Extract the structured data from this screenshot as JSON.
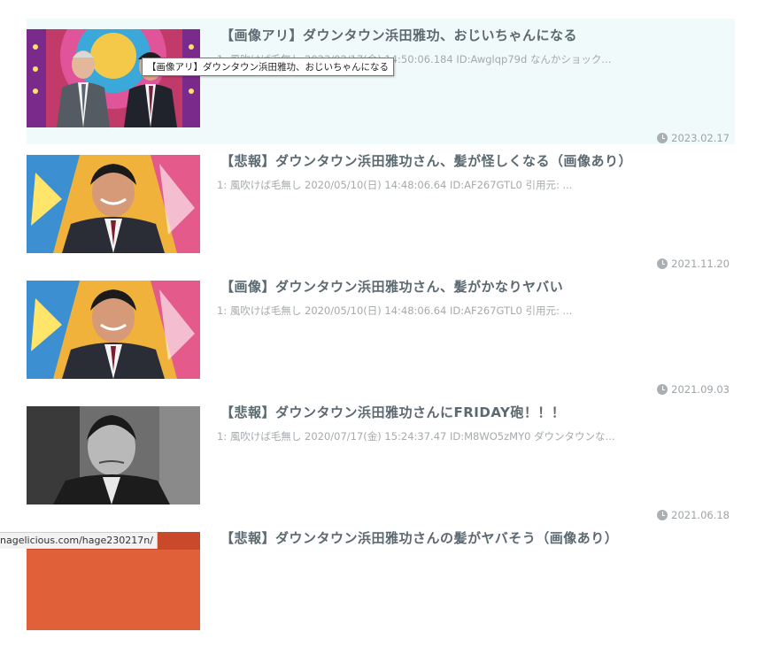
{
  "posts": [
    {
      "title": "【画像アリ】ダウンタウン浜田雅功、おじいちゃんになる",
      "excerpt": "1: 風吹けば毛無し 2023/02/17(金) 14:50:06.184 ID:Awglqp79d なんかショック...",
      "date": "2023.02.17"
    },
    {
      "title": "【悲報】ダウンタウン浜田雅功さん、髪が怪しくなる（画像あり）",
      "excerpt": "1: 風吹けば毛無し 2020/05/10(日) 14:48:06.64 ID:AF267GTL0 引用元: ...",
      "date": "2021.11.20"
    },
    {
      "title": "【画像】ダウンタウン浜田雅功さん、髪がかなりヤバい",
      "excerpt": "1: 風吹けば毛無し 2020/05/10(日) 14:48:06.64 ID:AF267GTL0 引用元: ...",
      "date": "2021.09.03"
    },
    {
      "title": "【悲報】ダウンタウン浜田雅功さんにFRIDAY砲！！！",
      "excerpt": "1: 風吹けば毛無し 2020/07/17(金) 15:24:37.47 ID:M8WO5zMY0 ダウンタウンな...",
      "date": "2021.06.18"
    },
    {
      "title": "【悲報】ダウンタウン浜田雅功さんの髪がヤバそう（画像あり）",
      "excerpt": "",
      "date": ""
    }
  ],
  "tooltip": "【画像アリ】ダウンタウン浜田雅功、おじいちゃんになる",
  "status_url": "nagelicious.com/hage230217n/",
  "icons": {
    "date": "clock-icon"
  }
}
